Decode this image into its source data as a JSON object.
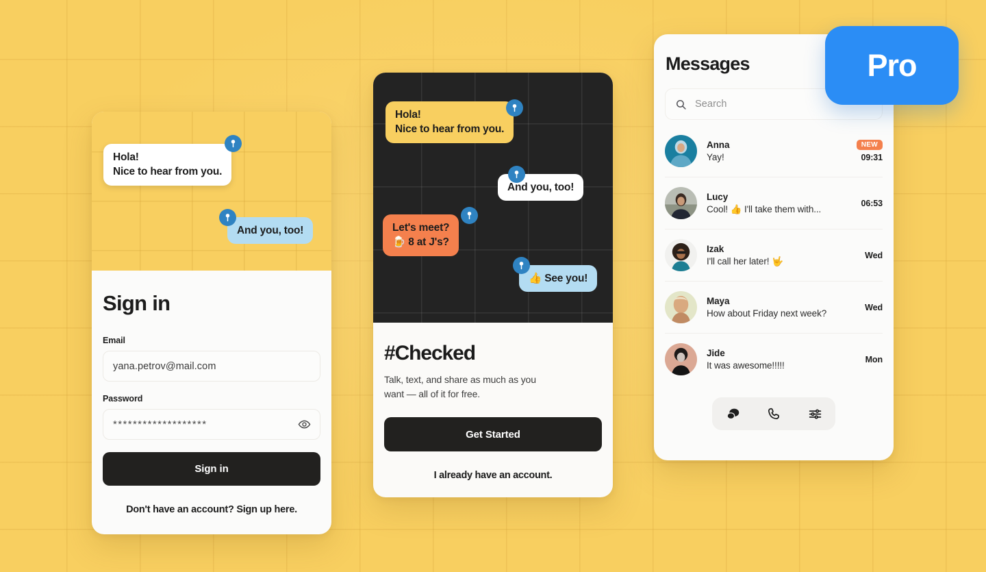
{
  "theme": {
    "background": "#f8cf60",
    "accent_blue": "#2b8df5",
    "accent_orange": "#f4804d",
    "bubble_blue": "#b3dcf2",
    "dark": "#22211f",
    "pin_blue": "#2f83c2"
  },
  "signin": {
    "hero_bubbles": [
      {
        "id": "hola",
        "lines": [
          "Hola!",
          "Nice to hear from you."
        ],
        "style": "white"
      },
      {
        "id": "andyou",
        "lines": [
          "And you, too!"
        ],
        "style": "blue"
      }
    ],
    "title": "Sign in",
    "email_label": "Email",
    "email_value": "yana.petrov@mail.com",
    "email_placeholder": "yana.petrov@mail.com",
    "password_label": "Password",
    "password_value": "*******************",
    "password_placeholder": "Password",
    "submit_label": "Sign in",
    "signup_link": "Don't have an account? Sign up here.",
    "eye_icon": "eye-icon"
  },
  "checked": {
    "chat_bubbles": [
      {
        "id": "hola",
        "lines": [
          "Hola!",
          "Nice to hear from you."
        ],
        "style": "yellow"
      },
      {
        "id": "andyou",
        "lines": [
          "And you, too!"
        ],
        "style": "white"
      },
      {
        "id": "letsmeet",
        "lines": [
          "Let's meet?",
          "🍺 8 at J's?"
        ],
        "style": "orange"
      },
      {
        "id": "seeyou",
        "lines": [
          "👍 See you!"
        ],
        "style": "blue"
      }
    ],
    "title": "#Checked",
    "subtitle": "Talk, text, and share as much as you want — all of it for free.",
    "cta_label": "Get Started",
    "secondary_link": "I already have an account."
  },
  "messages": {
    "title": "Messages",
    "search_placeholder": "Search",
    "search_value": "",
    "search_icon": "search-icon",
    "items": [
      {
        "name": "Anna",
        "preview": "Yay!",
        "time": "09:31",
        "badge": "NEW",
        "avatar": "anna-avatar"
      },
      {
        "name": "Lucy",
        "preview": "Cool! 👍 I'll take them with...",
        "time": "06:53",
        "badge": "",
        "avatar": "lucy-avatar"
      },
      {
        "name": "Izak",
        "preview": "I'll call her later! 🤟",
        "time": "Wed",
        "badge": "",
        "avatar": "izak-avatar"
      },
      {
        "name": "Maya",
        "preview": "How about Friday next week?",
        "time": "Wed",
        "badge": "",
        "avatar": "maya-avatar"
      },
      {
        "name": "Jide",
        "preview": "It was awesome!!!!!",
        "time": "Mon",
        "badge": "",
        "avatar": "jide-avatar"
      }
    ],
    "nav": [
      {
        "id": "chats",
        "icon": "chat-bubbles-icon",
        "active": true
      },
      {
        "id": "calls",
        "icon": "phone-icon",
        "active": false
      },
      {
        "id": "settings",
        "icon": "sliders-icon",
        "active": false
      }
    ]
  },
  "pro_badge": {
    "label": "Pro"
  }
}
